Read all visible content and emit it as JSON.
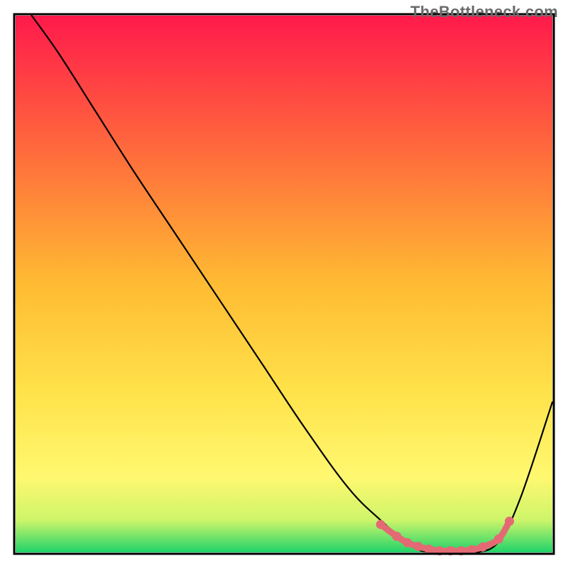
{
  "watermark": "TheBottleneck.com",
  "chart_data": {
    "type": "line",
    "title": "",
    "xlabel": "",
    "ylabel": "",
    "xlim": [
      0,
      100
    ],
    "ylim": [
      0,
      100
    ],
    "grid": false,
    "legend": false,
    "gradient": {
      "type": "vertical",
      "stops": [
        {
          "offset": 0,
          "color": "#ff1a4b"
        },
        {
          "offset": 25,
          "color": "#ff6a3c"
        },
        {
          "offset": 50,
          "color": "#ffbb33"
        },
        {
          "offset": 70,
          "color": "#ffe24a"
        },
        {
          "offset": 86,
          "color": "#fff870"
        },
        {
          "offset": 94,
          "color": "#cdf56a"
        },
        {
          "offset": 100,
          "color": "#20d36a"
        }
      ]
    },
    "series": [
      {
        "name": "bottleneck-curve",
        "color": "#000000",
        "x": [
          3,
          8,
          15,
          22,
          30,
          38,
          46,
          54,
          62,
          68,
          74,
          78,
          82,
          86,
          90,
          94,
          100
        ],
        "y": [
          100,
          93,
          82,
          71,
          59,
          47,
          35,
          23,
          12,
          6,
          1,
          0,
          0,
          0,
          2,
          10,
          28
        ]
      }
    ],
    "highlight": {
      "name": "optimal-range",
      "color": "#e36a74",
      "x": [
        68,
        71,
        73,
        75,
        77,
        79,
        81,
        83,
        85,
        87,
        90,
        92
      ],
      "y": [
        5.2,
        3.0,
        1.8,
        1.1,
        0.6,
        0.3,
        0.3,
        0.3,
        0.5,
        1.0,
        2.5,
        5.8
      ]
    }
  }
}
